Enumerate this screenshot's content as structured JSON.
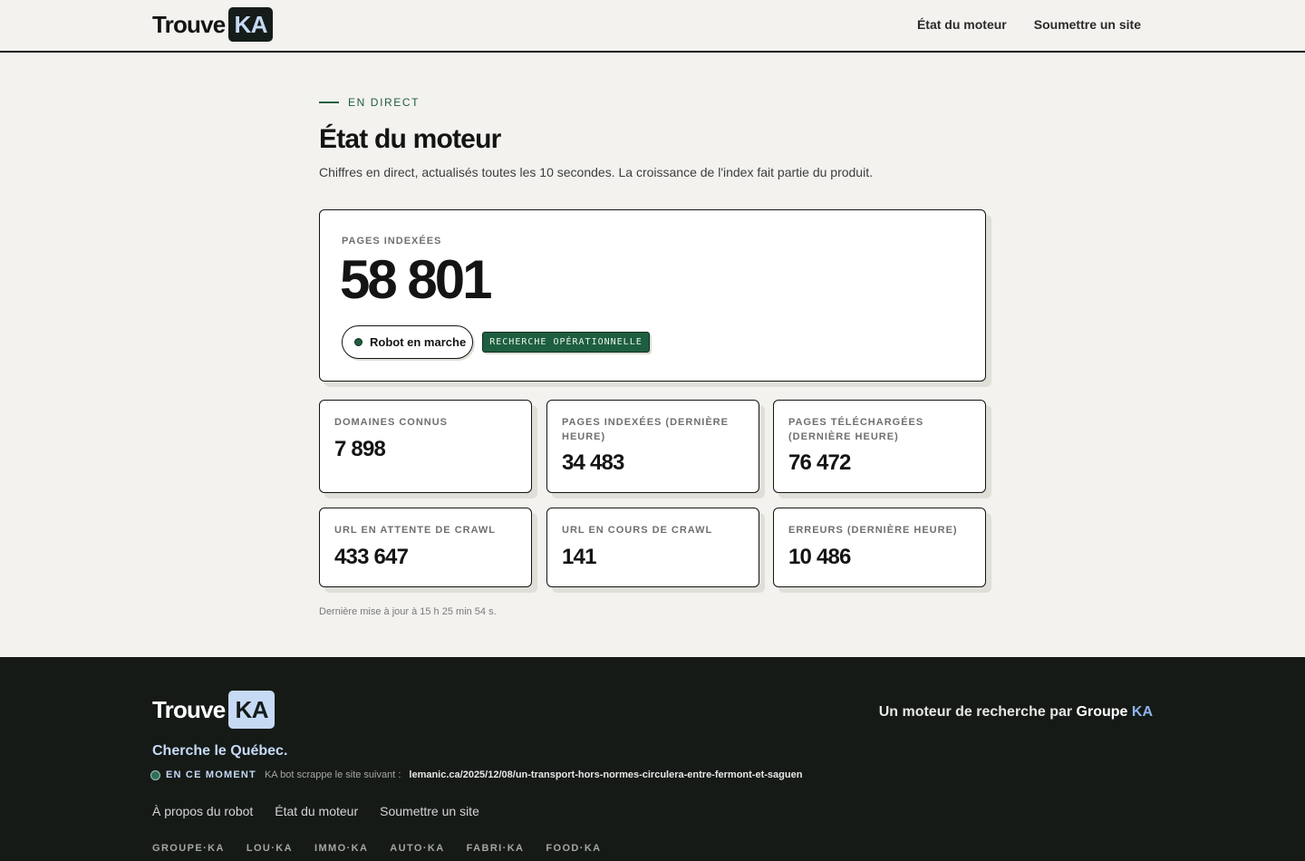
{
  "header": {
    "logo_word": "Trouve",
    "logo_badge": "KA",
    "nav": [
      "État du moteur",
      "Soumettre un site"
    ]
  },
  "main": {
    "eyebrow": "EN DIRECT",
    "title": "État du moteur",
    "subtitle": "Chiffres en direct, actualisés toutes les 10 secondes. La croissance de l'index fait partie du produit.",
    "hero": {
      "label": "PAGES INDEXÉES",
      "value": "58 801",
      "pill": "Robot en marche",
      "tag": "RECHERCHE OPÉRATIONNELLE"
    },
    "stats": [
      {
        "label": "DOMAINES CONNUS",
        "value": "7 898"
      },
      {
        "label": "PAGES INDEXÉES (DERNIÈRE HEURE)",
        "value": "34 483"
      },
      {
        "label": "PAGES TÉLÉCHARGÉES (DERNIÈRE HEURE)",
        "value": "76 472"
      },
      {
        "label": "URL EN ATTENTE DE CRAWL",
        "value": "433 647"
      },
      {
        "label": "URL EN COURS DE CRAWL",
        "value": "141"
      },
      {
        "label": "ERREURS (DERNIÈRE HEURE)",
        "value": "10 486"
      }
    ],
    "updated": "Dernière mise à jour à 15 h 25 min 54 s."
  },
  "footer": {
    "logo_word": "Trouve",
    "logo_badge": "KA",
    "tagline": "Cherche le Québec.",
    "byline_prefix": "Un moteur de recherche par",
    "byline_group": "Groupe",
    "byline_ka": "KA",
    "now_label": "EN CE MOMENT",
    "now_desc": "KA bot scrappe le site suivant :",
    "now_url": "lemanic.ca/2025/12/08/un-transport-hors-normes-circulera-entre-fermont-et-saguen",
    "links": [
      "À propos du robot",
      "État du moteur",
      "Soumettre un site"
    ],
    "brands": [
      "GROUPE·KA",
      "LOU·KA",
      "IMMO·KA",
      "AUTO·KA",
      "FABRI·KA",
      "FOOD·KA"
    ]
  },
  "colors": {
    "accent_green": "#1e5e40",
    "footer_bg": "#151a17",
    "badge_blue": "#c6daf5"
  }
}
